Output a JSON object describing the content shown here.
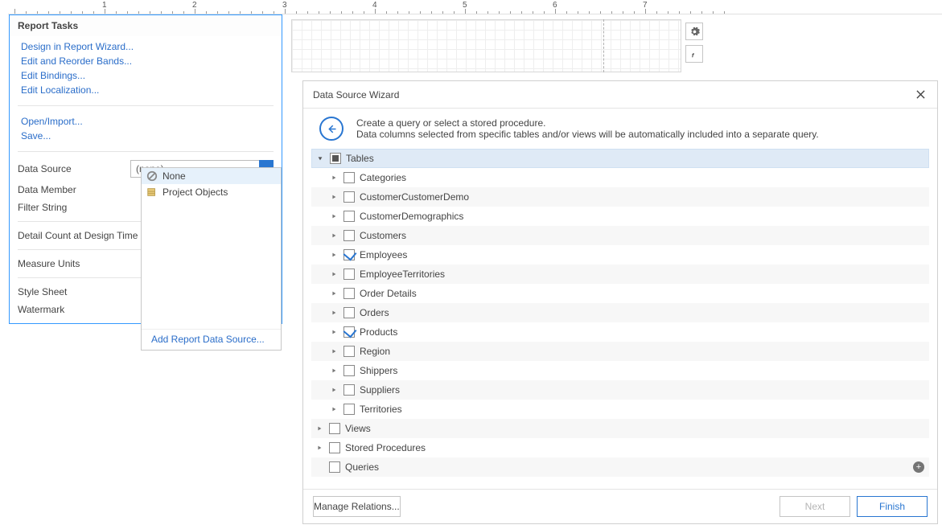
{
  "report_tasks": {
    "title": "Report Tasks",
    "links": {
      "design_wizard": "Design in Report Wizard...",
      "edit_bands": "Edit and Reorder Bands...",
      "edit_bindings": "Edit Bindings...",
      "edit_localization": "Edit Localization...",
      "open_import": "Open/Import...",
      "save": "Save..."
    },
    "rows": {
      "data_source": "Data Source",
      "data_source_value": "(none)",
      "data_member": "Data Member",
      "filter_string": "Filter String",
      "detail_count": "Detail Count at Design Time",
      "measure_units": "Measure Units",
      "style_sheet": "Style Sheet",
      "watermark": "Watermark"
    }
  },
  "ds_dropdown": {
    "none": "None",
    "project_objects": "Project Objects",
    "add_source": "Add Report Data Source..."
  },
  "ruler": {
    "labels": [
      "1",
      "2",
      "3",
      "4",
      "5",
      "6",
      "7"
    ]
  },
  "wizard": {
    "title": "Data Source Wizard",
    "intro_line1": "Create a query or select a stored procedure.",
    "intro_line2": "Data columns selected from specific tables and/or views will be automatically included into a separate query.",
    "tables_header": "Tables",
    "tables": [
      {
        "name": "Categories",
        "checked": false
      },
      {
        "name": "CustomerCustomerDemo",
        "checked": false
      },
      {
        "name": "CustomerDemographics",
        "checked": false
      },
      {
        "name": "Customers",
        "checked": false
      },
      {
        "name": "Employees",
        "checked": true
      },
      {
        "name": "EmployeeTerritories",
        "checked": false
      },
      {
        "name": "Order Details",
        "checked": false
      },
      {
        "name": "Orders",
        "checked": false
      },
      {
        "name": "Products",
        "checked": true
      },
      {
        "name": "Region",
        "checked": false
      },
      {
        "name": "Shippers",
        "checked": false
      },
      {
        "name": "Suppliers",
        "checked": false
      },
      {
        "name": "Territories",
        "checked": false
      }
    ],
    "views": "Views",
    "stored_procedures": "Stored Procedures",
    "queries": "Queries",
    "footer": {
      "manage_relations": "Manage Relations...",
      "next": "Next",
      "finish": "Finish"
    }
  }
}
